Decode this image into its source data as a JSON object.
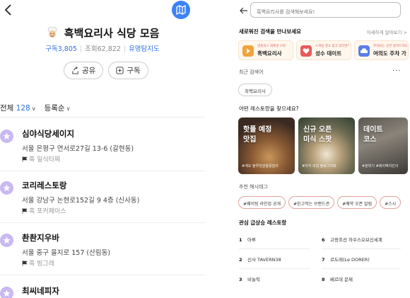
{
  "left": {
    "title": "흑백요리사 식당 모음",
    "meta": {
      "subscribers": "구독3,805",
      "views": "조회62,822",
      "popular": "유명탐지도"
    },
    "share_label": "공유",
    "subscribe_label": "구독",
    "filter": {
      "all_label": "전체",
      "count": "128",
      "order_label": "등록순"
    },
    "places": [
      {
        "name": "심야식당세이지",
        "address": "서울 은평구 연서로27길 13-6 (갈현동)",
        "tag": "흑 일식타짜"
      },
      {
        "name": "코리레스토랑",
        "address": "서울 강남구 논현로152길 9 4층 (신사동)",
        "tag": "흑 포커페이스"
      },
      {
        "name": "촨촨지우바",
        "address": "서울 중구 을지로 157 (산림동)",
        "tag": "흑 빙그레"
      },
      {
        "name": "최씨네피자",
        "address": "",
        "tag": ""
      }
    ]
  },
  "right": {
    "search_placeholder": "흑백요리사를 검색해보세요!",
    "new_section_title": "새로워진 검색을 만나보세요",
    "new_section_more": "자세하게 알아보기 >",
    "new_cards": [
      {
        "small": "넷플릭스 화제성 1위!",
        "big": "흑백요리사",
        "icon_color": "#f2a33a"
      },
      {
        "small": "소개팅 명소 찾고 있다면?",
        "big": "성수 데이트",
        "icon_color": "#e85a5a"
      },
      {
        "small": "주차되는 곳만 알려드려요",
        "big": "여의도 주차 가",
        "icon_color": "#5a7de8"
      }
    ],
    "recent_title": "최근 검색어",
    "recent_more": "···",
    "recent_chip": "흑백요리사",
    "find_title": "어떤 레스토랑을 찾으세요?",
    "photos": [
      {
        "title": "핫플 예정\n맛집",
        "hash": "#계모 블루맛깔총몽합리"
      },
      {
        "title": "신규 오픈\n미식 스팟",
        "hash": "#미식 모임 블로그이화"
      },
      {
        "title": "데이트\n코스",
        "hash": "#분위기 #레이팩치킨이"
      }
    ],
    "hashtag_title": "추천 해시태그",
    "hashtags": [
      "#웨이팅 라인업 공개",
      "#믿고먹는 브랜드관",
      "#예약 오픈 알림",
      "#스시"
    ],
    "trending_title": "관심 급상승 레스토랑",
    "ranks": [
      {
        "no": "1",
        "name": "아루"
      },
      {
        "no": "2",
        "name": "신사 TAVERN38"
      },
      {
        "no": "3",
        "name": "비놀릭"
      },
      {
        "no": "6",
        "name": "고랑조선 하우스오브신세계"
      },
      {
        "no": "7",
        "name": "르도레(Le DORER)"
      },
      {
        "no": "8",
        "name": "베르데 문제"
      }
    ]
  },
  "colors": {
    "accent_blue": "#2f6fe0",
    "map_button": "#3b82f6",
    "star_badge": "#c9b8f2"
  }
}
